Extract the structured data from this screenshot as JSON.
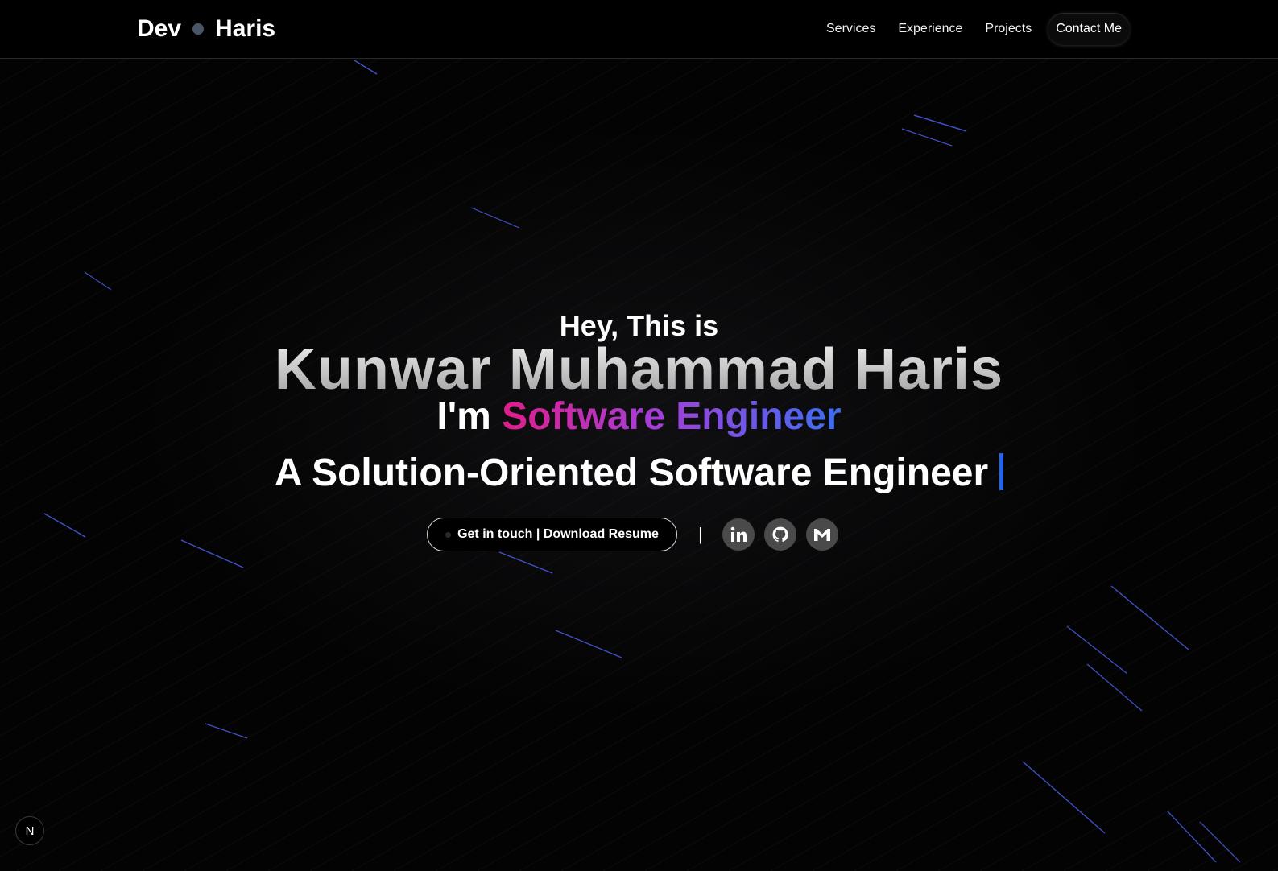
{
  "nav": {
    "logo_left": "Dev",
    "logo_right": "Haris",
    "links": [
      "Services",
      "Experience",
      "Projects"
    ],
    "contact_label": "Contact Me"
  },
  "hero": {
    "greeting": "Hey, This is",
    "name": "Kunwar Muhammad Haris",
    "role_prefix": "I'm",
    "role": "Software Engineer",
    "tagline": "A Solution-Oriented Software Engineer",
    "cta_label": "Get in touch | Download Resume",
    "separator": "|",
    "socials": [
      {
        "icon": "linkedin-icon"
      },
      {
        "icon": "github-icon"
      },
      {
        "icon": "gmail-icon"
      }
    ]
  },
  "badge": {
    "letter": "N"
  },
  "colors": {
    "background": "#000000",
    "role_gradient_start": "#e11d8a",
    "role_gradient_mid": "#a43fd8",
    "role_gradient_end": "#3b6ff0",
    "cursor": "#2563eb",
    "social_bg": "#4a4a4a"
  }
}
